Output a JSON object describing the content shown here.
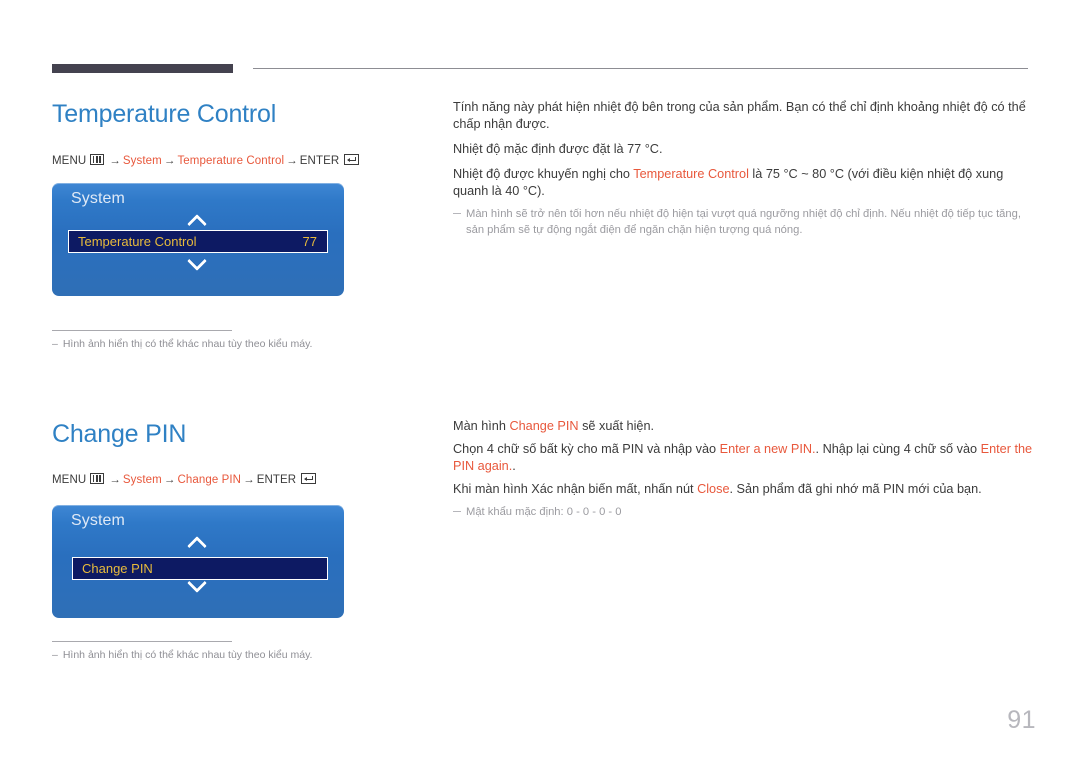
{
  "page": {
    "number": "91"
  },
  "sections": [
    {
      "heading": "Temperature Control",
      "menu_path": {
        "menu_label": "MENU",
        "menu_icon": "menu-grid-icon",
        "arrow": "→",
        "crumb1": "System",
        "crumb2": "Temperature Control",
        "enter_label": "ENTER",
        "enter_icon": "enter-return-icon"
      },
      "osd": {
        "title": "System",
        "up_icon": "chevron-up-icon",
        "down_icon": "chevron-down-icon",
        "row_label": "Temperature Control",
        "row_value": "77"
      },
      "footnote": {
        "dash": "–",
        "text": "Hình ảnh hiển thị có thể khác nhau tùy theo kiểu máy."
      },
      "body": {
        "p1_a": "Tính năng này phát hiện nhiệt độ bên trong của sản phẩm. Bạn có thể chỉ định khoảng nhiệt độ có thể chấp nhận được.",
        "p2_a": "Nhiệt độ mặc định được đặt là 77 °C.",
        "p3_a": "Nhiệt độ được khuyến nghị cho ",
        "p3_hl": "Temperature Control",
        "p3_b": " là 75 °C ~ 80 °C (với điều kiện nhiệt độ xung quanh là 40 °C).",
        "note": "Màn hình sẽ trở nên tối hơn nếu nhiệt độ hiện tại vượt quá ngưỡng nhiệt độ chỉ định. Nếu nhiệt độ tiếp tục tăng, sản phẩm sẽ tự động ngắt điện để ngăn chặn hiện tượng quá nóng."
      }
    },
    {
      "heading": "Change PIN",
      "menu_path": {
        "menu_label": "MENU",
        "menu_icon": "menu-grid-icon",
        "arrow": "→",
        "crumb1": "System",
        "crumb2": "Change PIN",
        "enter_label": "ENTER",
        "enter_icon": "enter-return-icon"
      },
      "osd": {
        "title": "System",
        "up_icon": "chevron-up-icon",
        "down_icon": "chevron-down-icon",
        "row_label": "Change PIN",
        "row_value": ""
      },
      "footnote": {
        "dash": "–",
        "text": "Hình ảnh hiển thị có thể khác nhau tùy theo kiểu máy."
      },
      "body": {
        "p1_a": "Màn hình ",
        "p1_hl": "Change PIN",
        "p1_b": " sẽ xuất hiện.",
        "p2_a": "Chọn 4 chữ số bất kỳ cho mã PIN và nhập vào ",
        "p2_hl1": "Enter a new PIN.",
        "p2_b": ". Nhập lại cùng 4 chữ số vào ",
        "p2_hl2": "Enter the PIN again.",
        "p2_c": ".",
        "p3_a": "Khi màn hình Xác nhận biến mất, nhấn nút ",
        "p3_hl": "Close",
        "p3_b": ". Sản phẩm đã ghi nhớ mã PIN mới của bạn.",
        "note": "Mật khẩu mặc định: 0 - 0 - 0 - 0"
      }
    }
  ],
  "colors": {
    "heading": "#2f81c4",
    "accent_orange": "#e8583c",
    "osd_gold": "#e8bb3c",
    "osd_blue": "#2a6fbe",
    "osd_row_navy": "#0d1a63",
    "rule_dark": "#44424f",
    "muted": "#9b9ba0"
  }
}
